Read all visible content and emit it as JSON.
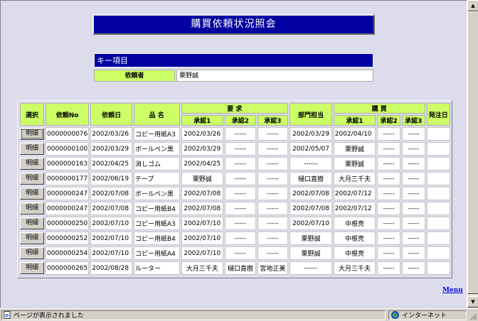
{
  "page": {
    "title": "購買依頼状況照会"
  },
  "key_section": {
    "header": "キー項目",
    "requester_label": "依頼者",
    "requester_value": "栗野誠"
  },
  "grid": {
    "headers": {
      "select": "選択",
      "request_no": "依頼No",
      "request_date": "依頼日",
      "item_name": "品 名",
      "demand": "要 求",
      "demand_approve1": "承認1",
      "demand_approve2": "承認2",
      "demand_approve3": "承認3",
      "dept_manager": "部門担当",
      "purchase": "購 買",
      "purchase_approve1": "承認1",
      "purchase_approve2": "承認2",
      "purchase_approve3": "承認3",
      "order_date": "発注日"
    },
    "detail_button_label": "明細",
    "rows": [
      [
        "0000000076",
        "2002/03/26",
        "コピー用紙A3",
        "2002/03/26",
        "-----",
        "-----",
        "2002/03/29",
        "2002/04/10",
        "-----",
        "-----",
        ""
      ],
      [
        "0000000100",
        "2002/03/29",
        "ボールペン黒",
        "2002/03/29",
        "-----",
        "-----",
        "2002/05/07",
        "栗野誠",
        "-----",
        "-----",
        ""
      ],
      [
        "0000000163",
        "2002/04/25",
        "消しゴム",
        "2002/04/25",
        "-----",
        "-----",
        "------",
        "栗野誠",
        "-----",
        "-----",
        ""
      ],
      [
        "0000000177",
        "2002/06/19",
        "テープ",
        "栗野誠",
        "-----",
        "-----",
        "樋口直樹",
        "大月三千夫",
        "-----",
        "-----",
        ""
      ],
      [
        "0000000247",
        "2002/07/08",
        "ボールペン黒",
        "2002/07/08",
        "-----",
        "-----",
        "2002/07/08",
        "2002/07/12",
        "-----",
        "-----",
        ""
      ],
      [
        "0000000247",
        "2002/07/08",
        "コピー用紙B4",
        "2002/07/08",
        "-----",
        "-----",
        "2002/07/08",
        "2002/07/12",
        "-----",
        "-----",
        ""
      ],
      [
        "0000000250",
        "2002/07/10",
        "コピー用紙A3",
        "2002/07/10",
        "-----",
        "-----",
        "2002/07/10",
        "中根亮",
        "-----",
        "-----",
        ""
      ],
      [
        "0000000252",
        "2002/07/10",
        "コピー用紙B4",
        "2002/07/10",
        "-----",
        "-----",
        "栗野誠",
        "中根亮",
        "-----",
        "-----",
        ""
      ],
      [
        "0000000254",
        "2002/07/10",
        "コピー用紙A4",
        "2002/07/10",
        "-----",
        "-----",
        "栗野誠",
        "中根亮",
        "-----",
        "-----",
        ""
      ],
      [
        "0000000265",
        "2002/08/28",
        "ルーター",
        "大月三千夫",
        "樋口直樹",
        "宮地正美",
        "------",
        "大月三千夫",
        "-----",
        "-----",
        ""
      ]
    ]
  },
  "menu_link": "Menu",
  "statusbar": {
    "message": "ページが表示されました",
    "zone": "インターネット"
  },
  "colors": {
    "title_bg": "#0000a0",
    "header_green": "#ccff66",
    "page_bg": "#dcdcec"
  }
}
